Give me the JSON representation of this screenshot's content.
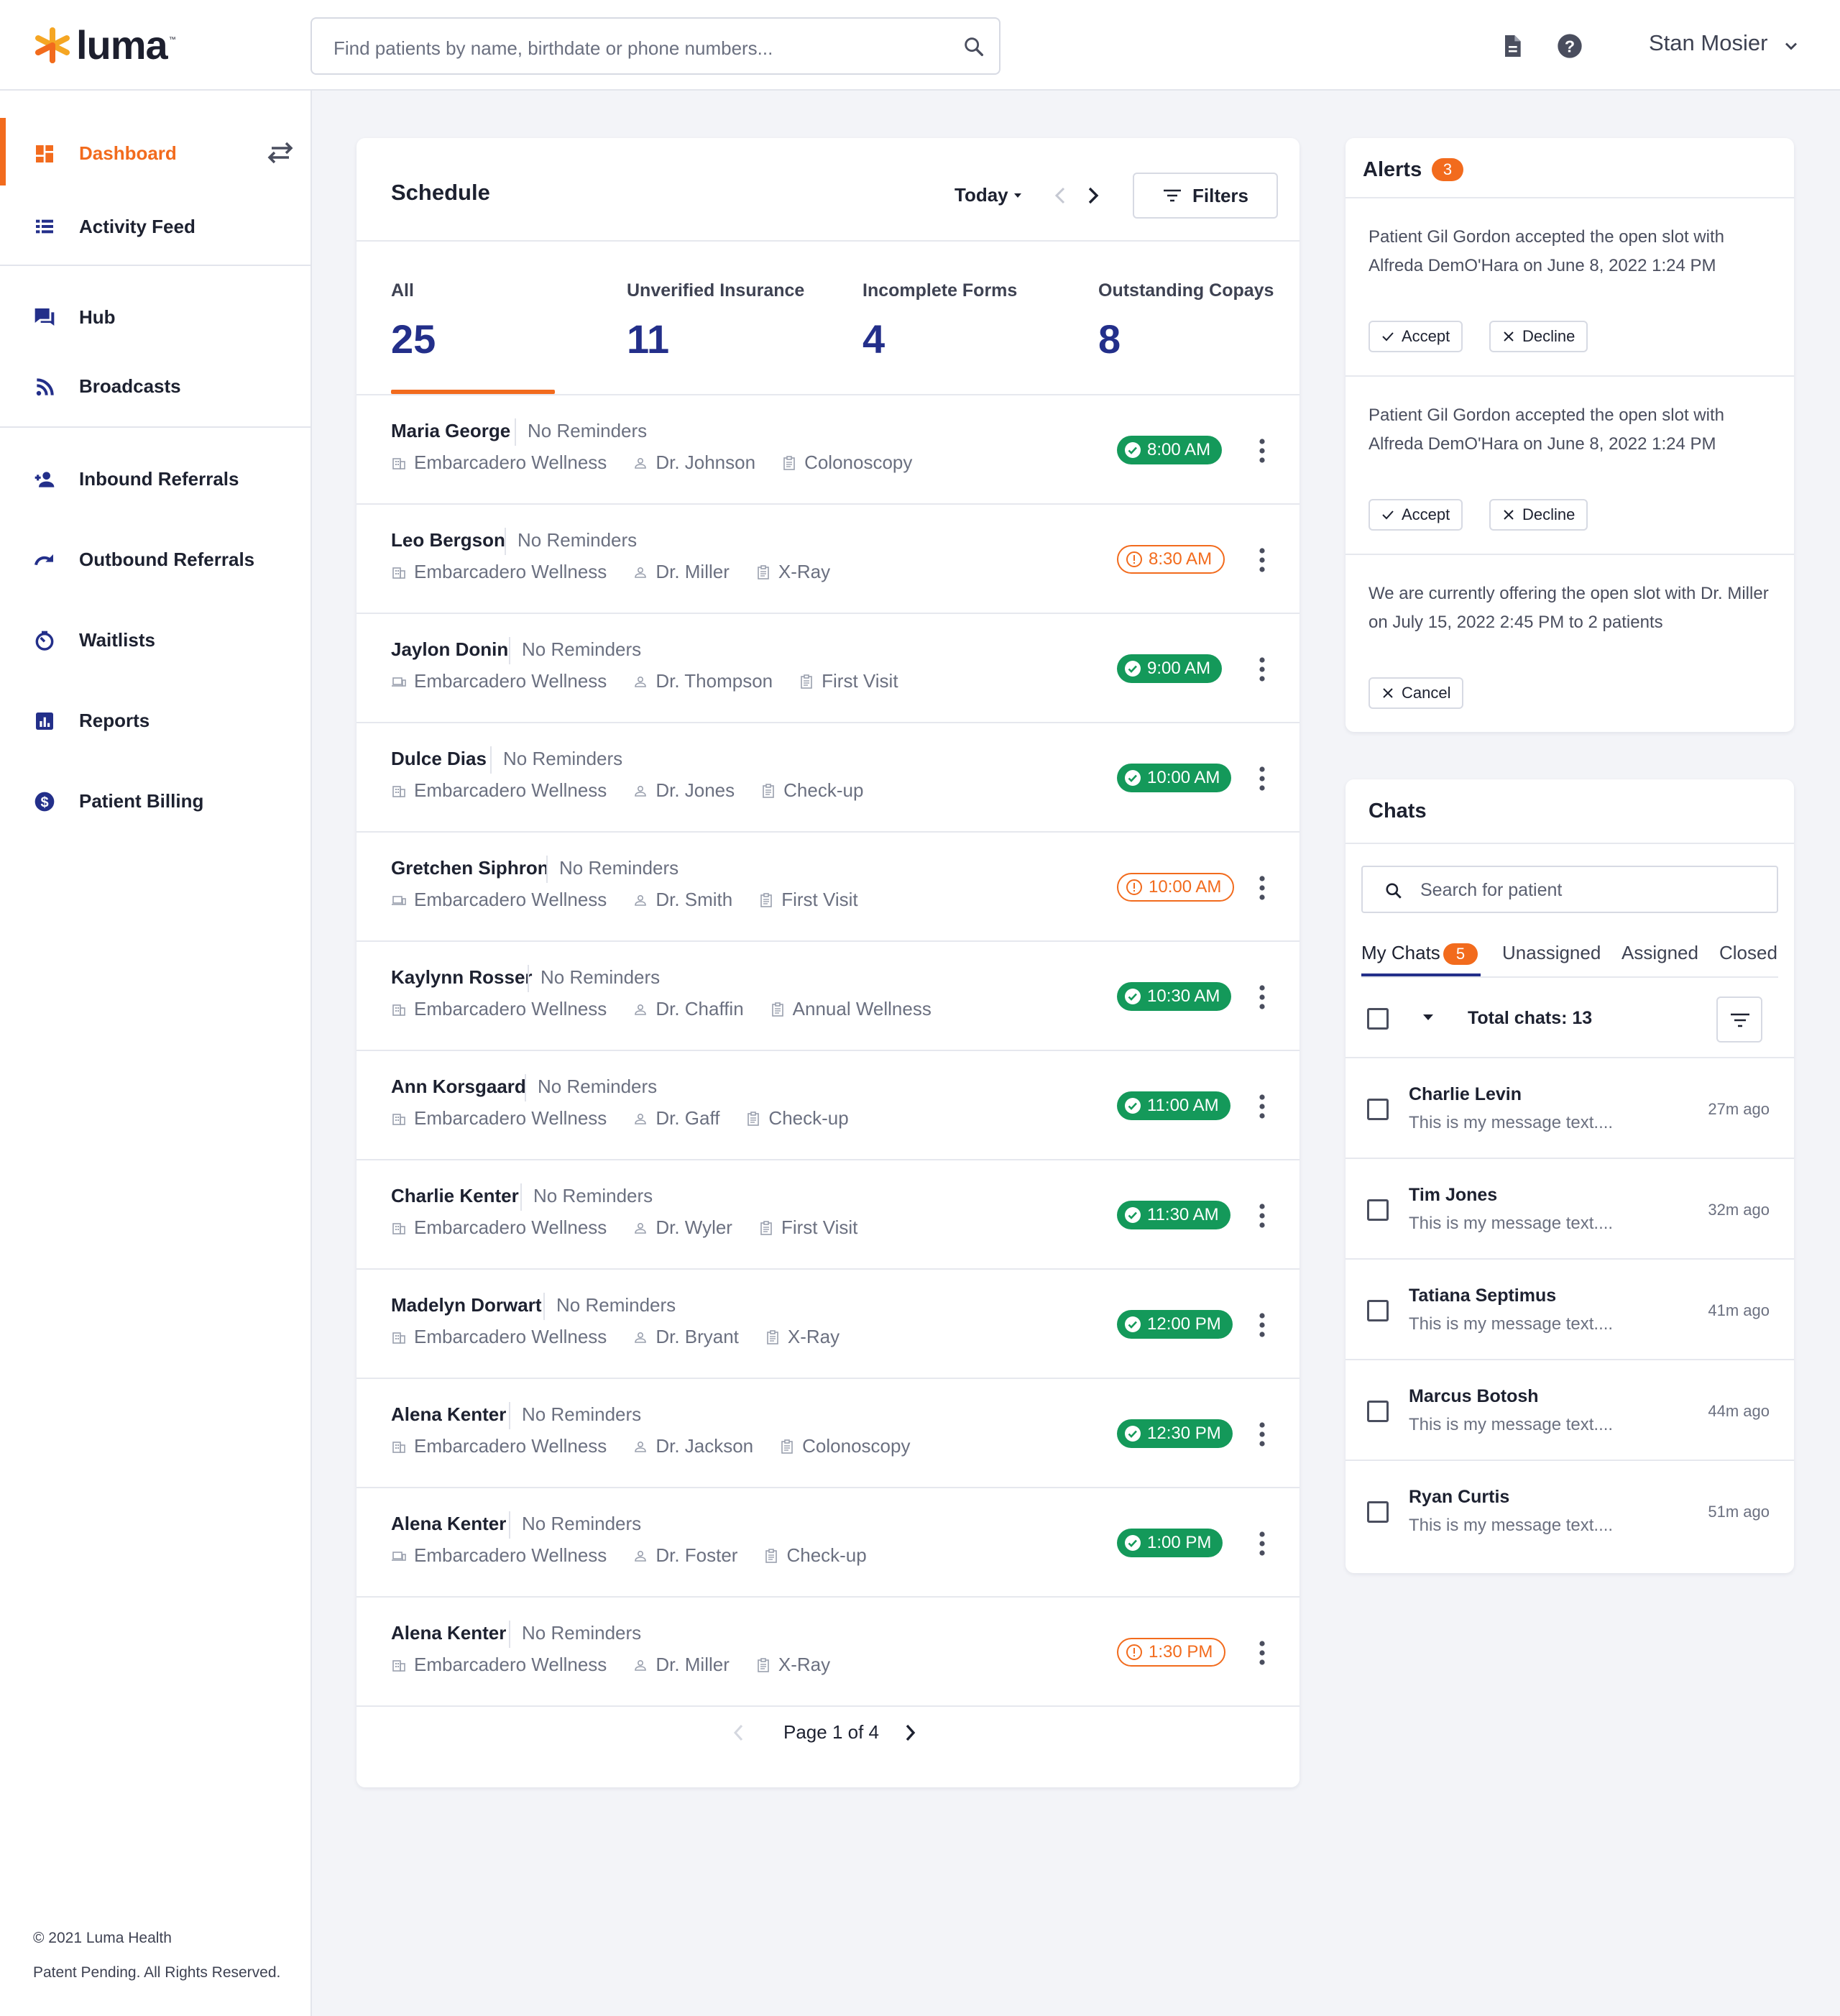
{
  "app": {
    "brand": "luma",
    "brand_color": "#f26b1d",
    "accent_color": "#232f8a",
    "success_color": "#14995a"
  },
  "header": {
    "search_placeholder": "Find patients by name, birthdate or phone numbers...",
    "user_name": "Stan Mosier",
    "icons": [
      "search-icon",
      "document-icon",
      "help-icon",
      "chevron-down-icon"
    ]
  },
  "sidebar": {
    "items": [
      {
        "label": "Dashboard",
        "icon": "dashboard-icon",
        "active": true
      },
      {
        "label": "Activity Feed",
        "icon": "list-icon"
      },
      {
        "label": "Hub",
        "icon": "chat-bubbles-icon"
      },
      {
        "label": "Broadcasts",
        "icon": "rss-icon"
      },
      {
        "label": "Inbound Referrals",
        "icon": "person-add-icon"
      },
      {
        "label": "Outbound Referrals",
        "icon": "redo-icon"
      },
      {
        "label": "Waitlists",
        "icon": "timer-icon"
      },
      {
        "label": "Reports",
        "icon": "bar-chart-icon"
      },
      {
        "label": "Patient Billing",
        "icon": "dollar-circle-icon"
      }
    ],
    "footer": {
      "copyright": "© 2021 Luma Health",
      "rights": "Patent Pending. All Rights Reserved."
    }
  },
  "schedule": {
    "title": "Schedule",
    "date_filter": "Today",
    "filters_label": "Filters",
    "stats": [
      {
        "label": "All",
        "value": "25"
      },
      {
        "label": "Unverified Insurance",
        "value": "11"
      },
      {
        "label": "Incomplete Forms",
        "value": "4"
      },
      {
        "label": "Outstanding Copays",
        "value": "8"
      }
    ],
    "rows": [
      {
        "name": "Maria George",
        "reminders": "No Reminders",
        "location": "Embarcadero Wellness",
        "doctor": "Dr. Johnson",
        "visit": "Colonoscopy",
        "time": "8:00 AM",
        "status": "ok"
      },
      {
        "name": "Leo Bergson",
        "reminders": "No Reminders",
        "location": "Embarcadero Wellness",
        "doctor": "Dr. Miller",
        "visit": "X-Ray",
        "time": "8:30 AM",
        "status": "warn"
      },
      {
        "name": "Jaylon Donin",
        "reminders": "No Reminders",
        "location": "Embarcadero Wellness",
        "doctor": "Dr. Thompson",
        "visit": "First Visit",
        "time": "9:00 AM",
        "status": "ok"
      },
      {
        "name": "Dulce Dias",
        "reminders": "No Reminders",
        "location": "Embarcadero Wellness",
        "doctor": "Dr. Jones",
        "visit": "Check-up",
        "time": "10:00 AM",
        "status": "ok"
      },
      {
        "name": "Gretchen Siphron",
        "reminders": "No Reminders",
        "location": "Embarcadero Wellness",
        "doctor": "Dr. Smith",
        "visit": "First Visit",
        "time": "10:00 AM",
        "status": "warn"
      },
      {
        "name": "Kaylynn Rosser",
        "reminders": "No Reminders",
        "location": "Embarcadero Wellness",
        "doctor": "Dr. Chaffin",
        "visit": "Annual Wellness",
        "time": "10:30 AM",
        "status": "ok"
      },
      {
        "name": "Ann Korsgaard",
        "reminders": "No Reminders",
        "location": "Embarcadero Wellness",
        "doctor": "Dr. Gaff",
        "visit": "Check-up",
        "time": "11:00 AM",
        "status": "ok"
      },
      {
        "name": "Charlie Kenter",
        "reminders": "No Reminders",
        "location": "Embarcadero Wellness",
        "doctor": "Dr. Wyler",
        "visit": "First Visit",
        "time": "11:30 AM",
        "status": "ok"
      },
      {
        "name": "Madelyn Dorwart",
        "reminders": "No Reminders",
        "location": "Embarcadero Wellness",
        "doctor": "Dr. Bryant",
        "visit": "X-Ray",
        "time": "12:00 PM",
        "status": "ok"
      },
      {
        "name": "Alena Kenter",
        "reminders": "No Reminders",
        "location": "Embarcadero Wellness",
        "doctor": "Dr. Jackson",
        "visit": "Colonoscopy",
        "time": "12:30 PM",
        "status": "ok"
      },
      {
        "name": "Alena Kenter",
        "reminders": "No Reminders",
        "location": "Embarcadero Wellness",
        "doctor": "Dr. Foster",
        "visit": "Check-up",
        "time": "1:00 PM",
        "status": "ok"
      },
      {
        "name": "Alena Kenter",
        "reminders": "No Reminders",
        "location": "Embarcadero Wellness",
        "doctor": "Dr. Miller",
        "visit": "X-Ray",
        "time": "1:30 PM",
        "status": "warn"
      }
    ],
    "pagination": {
      "label": "Page 1 of 4"
    }
  },
  "alerts": {
    "title": "Alerts",
    "count": "3",
    "items": [
      {
        "text": "Patient Gil Gordon accepted the open slot with Alfreda DemO'Hara on June 8, 2022 1:24 PM",
        "accept": "Accept",
        "decline": "Decline"
      },
      {
        "text": "Patient Gil Gordon accepted the open slot with Alfreda DemO'Hara on June 8, 2022 1:24 PM",
        "accept": "Accept",
        "decline": "Decline"
      },
      {
        "text": "We are currently offering the open slot with Dr. Miller on July 15, 2022 2:45 PM to 2 patients",
        "cancel": "Cancel"
      }
    ]
  },
  "chats": {
    "title": "Chats",
    "search_placeholder": "Search for patient",
    "tabs": [
      {
        "label": "My Chats",
        "badge": "5"
      },
      {
        "label": "Unassigned"
      },
      {
        "label": "Assigned"
      },
      {
        "label": "Closed"
      }
    ],
    "total_label": "Total chats: 13",
    "items": [
      {
        "name": "Charlie Levin",
        "message": "This is my message text....",
        "time": "27m ago"
      },
      {
        "name": "Tim Jones",
        "message": "This is my message text....",
        "time": "32m ago"
      },
      {
        "name": "Tatiana Septimus",
        "message": "This is my message text....",
        "time": "41m ago"
      },
      {
        "name": "Marcus Botosh",
        "message": "This is my message text....",
        "time": "44m ago"
      },
      {
        "name": "Ryan Curtis",
        "message": "This is my message text....",
        "time": "51m ago"
      }
    ]
  }
}
